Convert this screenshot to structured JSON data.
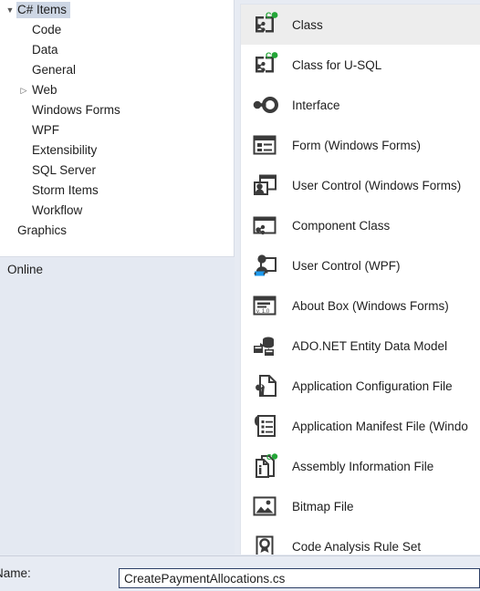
{
  "sidebar": {
    "tree": [
      {
        "label": "C# Items",
        "level": 1,
        "twisty": "expanded",
        "selected": true
      },
      {
        "label": "Code",
        "level": 2,
        "twisty": "none",
        "selected": false
      },
      {
        "label": "Data",
        "level": 2,
        "twisty": "none",
        "selected": false
      },
      {
        "label": "General",
        "level": 2,
        "twisty": "none",
        "selected": false
      },
      {
        "label": "Web",
        "level": 2,
        "twisty": "collapsed",
        "selected": false
      },
      {
        "label": "Windows Forms",
        "level": 2,
        "twisty": "none",
        "selected": false
      },
      {
        "label": "WPF",
        "level": 2,
        "twisty": "none",
        "selected": false
      },
      {
        "label": "Extensibility",
        "level": 2,
        "twisty": "none",
        "selected": false
      },
      {
        "label": "SQL Server",
        "level": 2,
        "twisty": "none",
        "selected": false
      },
      {
        "label": "Storm Items",
        "level": 2,
        "twisty": "none",
        "selected": false
      },
      {
        "label": "Workflow",
        "level": 2,
        "twisty": "none",
        "selected": false
      },
      {
        "label": "Graphics",
        "level": 1,
        "twisty": "none",
        "selected": false
      }
    ],
    "online": {
      "label": "Online"
    }
  },
  "template_list": {
    "items": [
      {
        "label": "Class",
        "icon": "class-icon",
        "selected": true
      },
      {
        "label": "Class for U-SQL",
        "icon": "class-icon",
        "selected": false
      },
      {
        "label": "Interface",
        "icon": "interface-icon",
        "selected": false
      },
      {
        "label": "Form (Windows Forms)",
        "icon": "form-icon",
        "selected": false
      },
      {
        "label": "User Control (Windows Forms)",
        "icon": "user-control-winforms-icon",
        "selected": false
      },
      {
        "label": "Component Class",
        "icon": "component-class-icon",
        "selected": false
      },
      {
        "label": "User Control (WPF)",
        "icon": "user-control-wpf-icon",
        "selected": false
      },
      {
        "label": "About Box (Windows Forms)",
        "icon": "about-box-icon",
        "selected": false
      },
      {
        "label": "ADO.NET Entity Data Model",
        "icon": "entity-data-model-icon",
        "selected": false
      },
      {
        "label": "Application Configuration File",
        "icon": "app-config-file-icon",
        "selected": false
      },
      {
        "label": "Application Manifest File (Windo",
        "icon": "app-manifest-file-icon",
        "selected": false
      },
      {
        "label": "Assembly Information File",
        "icon": "assembly-info-file-icon",
        "selected": false
      },
      {
        "label": "Bitmap File",
        "icon": "bitmap-file-icon",
        "selected": false
      },
      {
        "label": "Code Analysis Rule Set",
        "icon": "code-analysis-rule-set-icon",
        "selected": false
      }
    ]
  },
  "bottom": {
    "name_label": "Name:",
    "name_value": "CreatePaymentAllocations.cs",
    "name_placeholder": "Name"
  },
  "colors": {
    "selection": "#ededed",
    "tree_selection": "#cdd6e4",
    "panel_bg": "#e7ebf3",
    "input_border": "#2c3f66",
    "icon_accent_green": "#23a637",
    "icon_accent_blue": "#1d9bf0"
  }
}
